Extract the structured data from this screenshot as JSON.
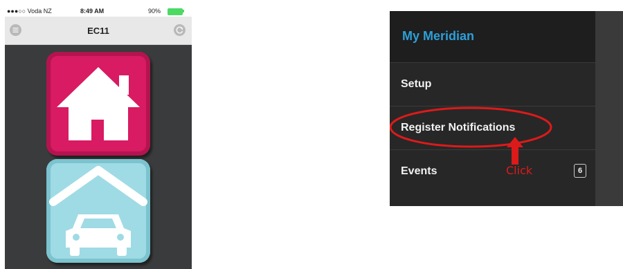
{
  "phone": {
    "status": {
      "carrier": "●●●○○ Voda NZ",
      "time": "8:49 AM",
      "battery": "90%"
    },
    "nav": {
      "title": "EC11"
    },
    "icons": {
      "menu": "hamburger-icon",
      "refresh": "refresh-icon",
      "home": "house-icon",
      "garage": "garage-car-icon"
    },
    "colors": {
      "home_tile": "#d81b62",
      "garage_tile": "#9fdbe4",
      "background": "#3a3b3c"
    }
  },
  "menu": {
    "brand": "My Meridian",
    "items": [
      {
        "label": "Setup"
      },
      {
        "label": "Register Notifications"
      },
      {
        "label": "Events",
        "badge": "6"
      }
    ],
    "annotation": "Click",
    "colors": {
      "brand": "#2d9fd8",
      "annotation": "#dd1a1a"
    }
  }
}
